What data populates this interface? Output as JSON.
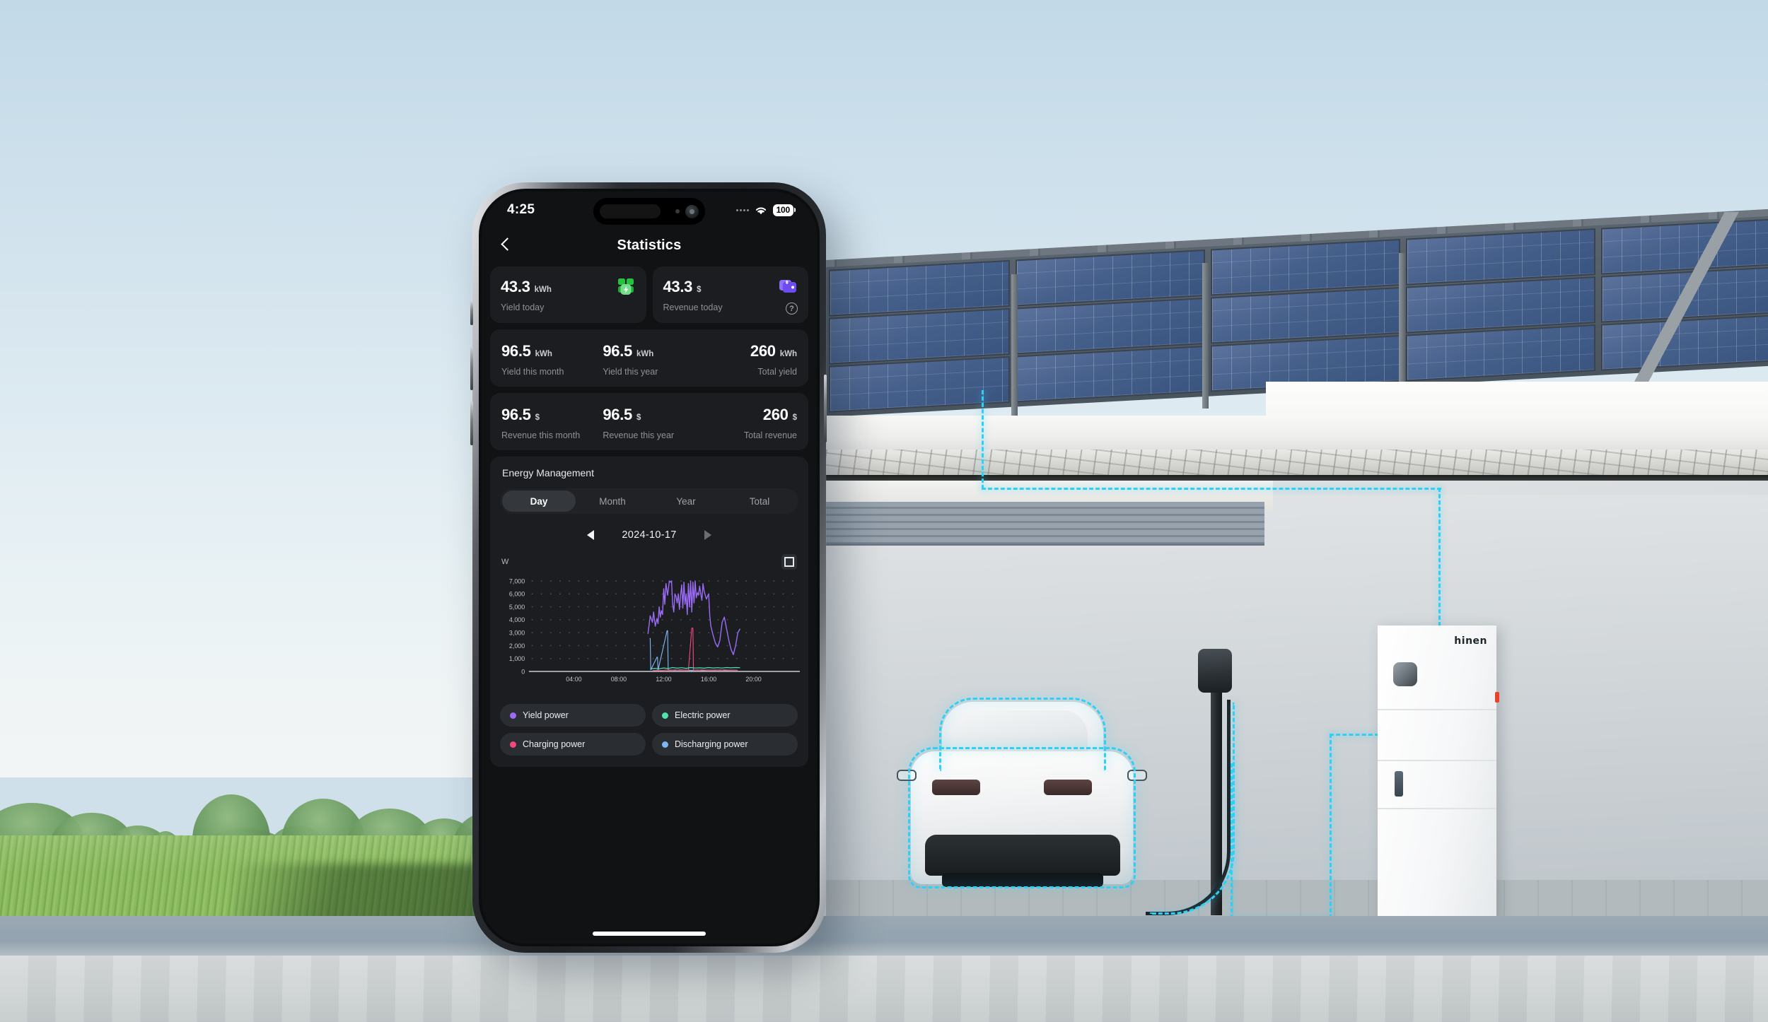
{
  "scene": {
    "battery_brand": "hinen"
  },
  "phone": {
    "status_bar": {
      "time": "4:25",
      "battery_percent": "100",
      "wifi_icon": "wifi-icon",
      "signal_icon": "signal-dots-icon"
    },
    "nav": {
      "back_icon": "chevron-left-icon",
      "title": "Statistics"
    },
    "today_cards": [
      {
        "value": "43.3",
        "unit": "kWh",
        "label": "Yield today",
        "icon": "solar-panel-bolt-icon",
        "icon_color": "#2fc949"
      },
      {
        "value": "43.3",
        "unit": "$",
        "label": "Revenue today",
        "icon": "wallet-dollar-icon",
        "icon_color": "#7c5cfa",
        "help_icon": "question-circle-icon"
      }
    ],
    "yield_row": [
      {
        "value": "96.5",
        "unit": "kWh",
        "label": "Yield this month"
      },
      {
        "value": "96.5",
        "unit": "kWh",
        "label": "Yield this year"
      },
      {
        "value": "260",
        "unit": "kWh",
        "label": "Total yield"
      }
    ],
    "revenue_row": [
      {
        "value": "96.5",
        "unit": "$",
        "label": "Revenue this month"
      },
      {
        "value": "96.5",
        "unit": "$",
        "label": "Revenue this year"
      },
      {
        "value": "260",
        "unit": "$",
        "label": "Total revenue"
      }
    ],
    "energy_management": {
      "title": "Energy Management",
      "tabs": [
        {
          "label": "Day",
          "active": true
        },
        {
          "label": "Month",
          "active": false
        },
        {
          "label": "Year",
          "active": false
        },
        {
          "label": "Total",
          "active": false
        }
      ],
      "date": {
        "prev_icon": "triangle-left-icon",
        "value": "2024-10-17",
        "next_icon": "triangle-right-icon"
      },
      "chart_unit": "W",
      "expand_icon": "expand-fullscreen-icon",
      "legend": [
        {
          "label": "Yield power",
          "color": "#9b6bf5"
        },
        {
          "label": "Electric power",
          "color": "#4fe3b0"
        },
        {
          "label": "Charging power",
          "color": "#f2497a"
        },
        {
          "label": "Discharging power",
          "color": "#7eb6f5"
        }
      ]
    }
  },
  "chart_data": {
    "type": "line",
    "title": "",
    "xlabel": "",
    "ylabel": "W",
    "unit": "W",
    "ylim": [
      0,
      7000
    ],
    "yticks": [
      0,
      1000,
      2000,
      3000,
      4000,
      5000,
      6000,
      7000
    ],
    "ytick_labels": [
      "0",
      "1,000",
      "2,000",
      "3,000",
      "4,000",
      "5,000",
      "6,000",
      "7,000"
    ],
    "xlim": [
      "00:00",
      "24:00"
    ],
    "xticks": [
      "04:00",
      "08:00",
      "12:00",
      "16:00",
      "20:00"
    ],
    "grid": "dotted-horizontal",
    "legend_position": "below",
    "series": [
      {
        "name": "Yield power",
        "color": "#9b6bf5",
        "x": [
          10.6,
          10.8,
          11.0,
          11.1,
          11.25,
          11.4,
          11.5,
          11.6,
          11.7,
          11.8,
          11.9,
          12.0,
          12.1,
          12.2,
          12.35,
          12.5,
          12.6,
          12.7,
          12.8,
          12.9,
          13.0,
          13.1,
          13.2,
          13.3,
          13.4,
          13.5,
          13.6,
          13.7,
          13.8,
          13.9,
          14.0,
          14.1,
          14.2,
          14.3,
          14.4,
          14.5,
          14.6,
          14.7,
          14.8,
          14.9,
          15.0,
          15.1,
          15.2,
          15.3,
          15.4,
          15.5,
          15.6,
          15.7,
          15.8,
          15.9,
          16.0,
          16.1,
          16.2,
          16.4,
          16.6,
          16.8,
          17.0,
          17.2,
          17.4,
          17.6,
          17.8,
          18.0,
          18.2,
          18.4,
          18.6,
          18.8
        ],
        "y": [
          2900,
          4300,
          3800,
          4600,
          3500,
          4100,
          3700,
          5000,
          4200,
          4700,
          4400,
          6400,
          5200,
          6800,
          5900,
          7000,
          6900,
          7000,
          5200,
          4600,
          6000,
          5800,
          5300,
          6000,
          4800,
          5900,
          6700,
          4900,
          6900,
          5200,
          6000,
          4400,
          6800,
          5000,
          7000,
          4600,
          6900,
          5300,
          7000,
          5700,
          6100,
          5900,
          6600,
          6000,
          5500,
          6800,
          6200,
          5900,
          5600,
          5800,
          6000,
          4300,
          3500,
          2800,
          2200,
          1900,
          2400,
          3800,
          4200,
          3300,
          2400,
          1700,
          1300,
          2000,
          3000,
          3300
        ]
      },
      {
        "name": "Electric power",
        "color": "#4fe3b0",
        "x": [
          10.8,
          11.2,
          11.6,
          12.0,
          12.4,
          12.8,
          13.2,
          13.6,
          14.0,
          14.4,
          14.8,
          15.2,
          15.6,
          16.0,
          16.4,
          16.8,
          17.2,
          17.6,
          18.0,
          18.4,
          18.8
        ],
        "y": [
          180,
          240,
          210,
          270,
          230,
          300,
          250,
          290,
          240,
          300,
          260,
          280,
          250,
          300,
          270,
          290,
          260,
          300,
          280,
          300,
          290
        ]
      },
      {
        "name": "Charging power",
        "color": "#f2497a",
        "x": [
          11.0,
          11.4,
          11.8,
          12.2,
          12.6,
          13.0,
          13.4,
          13.8,
          14.2,
          14.5,
          14.55,
          14.6,
          14.65,
          15.0,
          15.4,
          15.8,
          16.2,
          16.6,
          17.0,
          17.4,
          17.8,
          18.2,
          18.6
        ],
        "y": [
          60,
          90,
          70,
          110,
          80,
          120,
          90,
          100,
          80,
          3350,
          3350,
          3350,
          110,
          90,
          120,
          100,
          80,
          110,
          90,
          120,
          100,
          90,
          80
        ]
      },
      {
        "name": "Discharging power",
        "color": "#7eb6f5",
        "x": [
          10.75,
          10.8,
          10.85,
          11.4,
          11.45,
          11.5,
          12.3,
          12.35,
          12.4,
          13.0,
          13.5,
          14.0,
          14.5,
          15.0,
          15.5,
          16.0,
          16.5,
          17.0,
          17.5,
          18.0,
          18.5
        ],
        "y": [
          2550,
          2550,
          120,
          1100,
          1100,
          100,
          3150,
          3150,
          110,
          90,
          120,
          100,
          80,
          110,
          70,
          100,
          90,
          110,
          80,
          95,
          85
        ]
      }
    ]
  }
}
